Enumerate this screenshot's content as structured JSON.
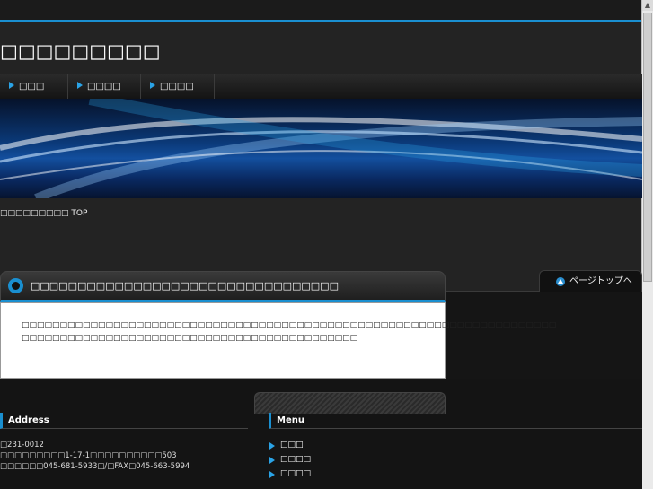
{
  "site": {
    "title": "□□□□□□□□□"
  },
  "nav": {
    "items": [
      "□□□",
      "□□□□",
      "□□□□"
    ]
  },
  "breadcrumb": "□□□□□□□□□ TOP",
  "pagetop": {
    "label": "ページトップへ"
  },
  "content": {
    "heading": "□□□□□□□□□□□□□□□□□□□□□□□□□□□□□□□□□",
    "lines": [
      "□□□□□□□□□□□□□□□□□□□□□□□□□□□□□□□□□□□□□□□□□□□□□□□□□□□□□□□□□□□□□□□□□□□□□□",
      "□□□□□□□□□□□□□□□□□□□□□□□□□□□□□□□□□□□□□□□□□□□□"
    ]
  },
  "footer": {
    "address_heading": "Address",
    "address_lines": [
      "□231-0012",
      "□□□□□□□□□1-17-1□□□□□□□□□□503",
      "□□□□□□045-681-5933□/□FAX□045-663-5994"
    ],
    "menu_heading": "Menu",
    "menu_items": [
      "□□□",
      "□□□□",
      "□□□□"
    ]
  },
  "colors": {
    "accent": "#1a8fd0",
    "background": "#232323"
  }
}
